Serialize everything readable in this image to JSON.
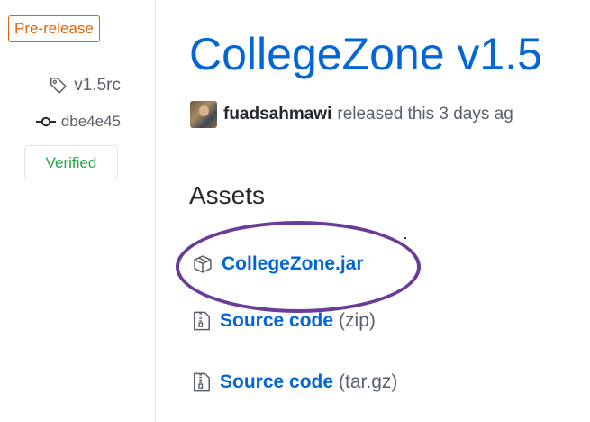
{
  "sidebar": {
    "prerelease_label": "Pre-release",
    "tag_name": "v1.5rc",
    "commit_sha": "dbe4e45",
    "verified_label": "Verified"
  },
  "release": {
    "title": "CollegeZone v1.5",
    "author": "fuadsahmawi",
    "released_text": "released this 3 days ag"
  },
  "assets": {
    "heading": "Assets",
    "items": [
      {
        "name": "CollegeZone.jar",
        "ext": "",
        "icon": "package-icon"
      },
      {
        "name": "Source code",
        "ext": "(zip)",
        "icon": "file-zip-icon"
      },
      {
        "name": "Source code",
        "ext": "(tar.gz)",
        "icon": "file-zip-icon"
      }
    ]
  },
  "colors": {
    "link": "#0366d6",
    "prerelease": "#e36209",
    "verified": "#28a745",
    "annotation": "#6a3c97"
  }
}
